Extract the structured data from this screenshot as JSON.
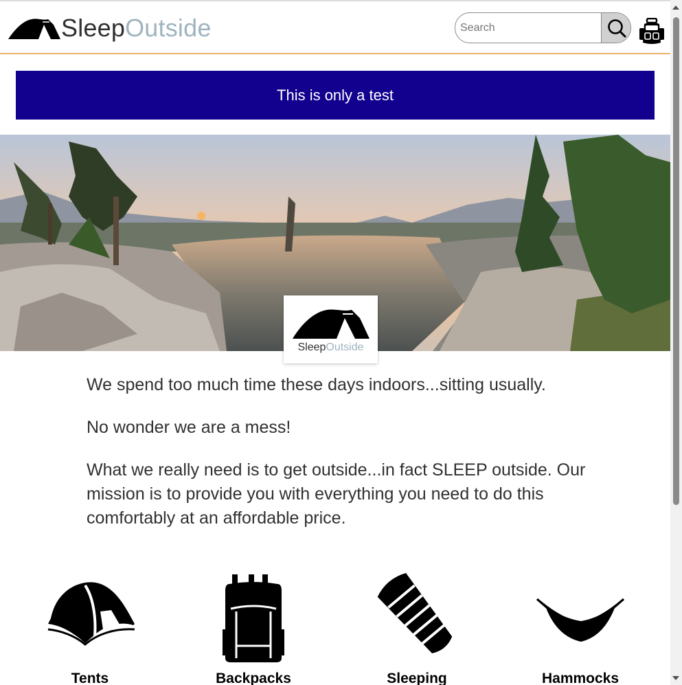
{
  "header": {
    "logo": {
      "part1": "Sleep",
      "part2": "Outside"
    },
    "search": {
      "placeholder": "Search",
      "value": "",
      "icon": "search-icon"
    },
    "cart": {
      "icon": "backpack-cart-icon"
    }
  },
  "alert": {
    "message": "This is only a test",
    "background": "#12008e"
  },
  "hero": {
    "image": "mountain-lake-panorama",
    "logo": {
      "part1": "Sleep",
      "part2": "Outside"
    }
  },
  "mission": {
    "paragraphs": [
      "We spend too much time these days indoors...sitting usually.",
      "No wonder we are a mess!",
      "What we really need is to get outside...in fact SLEEP outside. Our mission is to provide you with everything you need to do this comfortably at an affordable price."
    ]
  },
  "categories": [
    {
      "label": "Tents",
      "icon": "tent-icon"
    },
    {
      "label": "Backpacks",
      "icon": "backpack-icon"
    },
    {
      "label": "Sleeping",
      "icon": "sleeping-bag-icon"
    },
    {
      "label": "Hammocks",
      "icon": "hammock-icon"
    }
  ],
  "colors": {
    "accent_border": "#e8b36a",
    "logo_outside": "#9fb4c0",
    "text": "#303030"
  }
}
